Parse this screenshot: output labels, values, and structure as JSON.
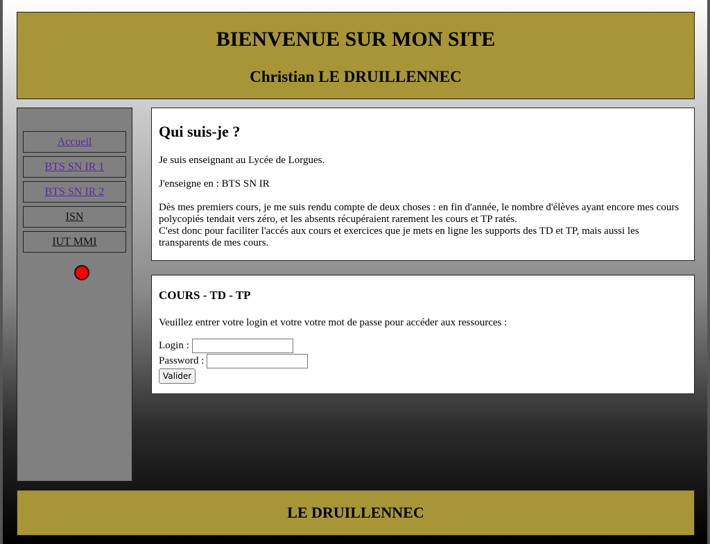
{
  "header": {
    "title": "BIENVENUE SUR MON SITE",
    "subtitle": "Christian LE DRUILLENNEC"
  },
  "sidebar": {
    "items": [
      {
        "label": "Accueil",
        "visited": true
      },
      {
        "label": "BTS SN IR 1",
        "visited": true
      },
      {
        "label": "BTS SN IR 2",
        "visited": true
      },
      {
        "label": "ISN",
        "visited": false
      },
      {
        "label": "IUT MMI",
        "visited": false
      }
    ],
    "indicator": {
      "icon": "red-dot",
      "color": "#ff0000"
    }
  },
  "about": {
    "title": "Qui suis-je ?",
    "paragraph1": "Je suis enseignant au Lycée de Lorgues.",
    "paragraph2": "J'enseigne en : BTS SN IR",
    "paragraph3_line1": "Dès mes premiers cours, je me suis rendu compte de deux choses : en fin d'année, le nombre d'élèves ayant encore mes cours polycopiés tendait vers zéro, et les absents récupéraient rarement les cours et TP ratés.",
    "paragraph3_line2": "C'est donc pour faciliter l'accés aux cours et exercices que je mets en ligne les supports des TD et TP, mais aussi les transparents de mes cours."
  },
  "courses": {
    "title": "COURS - TD - TP",
    "instructions": "Veuillez entrer votre login et votre votre mot de passe pour accéder aux ressources :",
    "login_label": "Login :",
    "login_value": "",
    "password_label": "Password :",
    "password_value": "",
    "submit_label": "Valider"
  },
  "footer": {
    "text": "LE DRUILLENNEC"
  },
  "colors": {
    "header_bg": "#a89538",
    "sidebar_bg": "#808080",
    "visited_link": "#5a2a9e"
  }
}
